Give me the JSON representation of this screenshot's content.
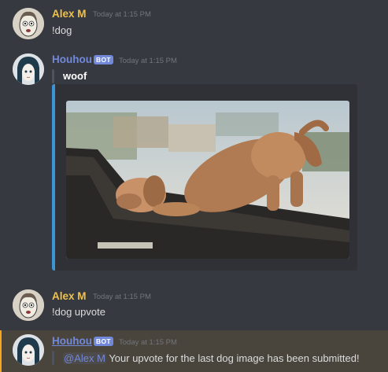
{
  "messages": [
    {
      "author": "Alex M",
      "timestamp": "Today at 1:15 PM",
      "content": "!dog"
    },
    {
      "author": "Houhou",
      "bot_tag": "BOT",
      "timestamp": "Today at 1:15 PM",
      "content": "woof"
    },
    {
      "author": "Alex M",
      "timestamp": "Today at 1:15 PM",
      "content": "!dog upvote"
    },
    {
      "author": "Houhou",
      "bot_tag": "BOT",
      "timestamp": "Today at 1:15 PM",
      "mention": "@Alex M",
      "content": "Your upvote for the last dog image has been submitted!"
    }
  ],
  "embed": {
    "accent_color": "#3b95d5",
    "image_description": "dog stretching on car dashboard"
  },
  "colors": {
    "background": "#36393f",
    "user_name": "#f0c24b",
    "bot_name": "#7289da",
    "highlight": "#49443c",
    "highlight_bar": "#faa61a"
  }
}
